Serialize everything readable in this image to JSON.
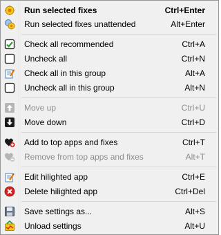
{
  "menu": {
    "items": [
      {
        "label": "Run selected fixes",
        "shortcut": "Ctrl+Enter",
        "icon": "run-icon"
      },
      {
        "label": "Run selected fixes unattended",
        "shortcut": "Alt+Enter",
        "icon": "run-unattended-icon"
      },
      {
        "label": "Check all recommended",
        "shortcut": "Ctrl+A",
        "icon": "checkbox-checked-icon"
      },
      {
        "label": "Uncheck all",
        "shortcut": "Ctrl+N",
        "icon": "checkbox-empty-icon"
      },
      {
        "label": "Check all in this group",
        "shortcut": "Alt+A",
        "icon": "group-check-icon"
      },
      {
        "label": "Uncheck all in this group",
        "shortcut": "Alt+N",
        "icon": "checkbox-empty-icon"
      },
      {
        "label": "Move up",
        "shortcut": "Ctrl+U",
        "icon": "arrow-up-icon",
        "disabled": true
      },
      {
        "label": "Move down",
        "shortcut": "Ctrl+D",
        "icon": "arrow-down-icon"
      },
      {
        "label": "Add to top apps and fixes",
        "shortcut": "Ctrl+T",
        "icon": "heart-add-icon"
      },
      {
        "label": "Remove from top apps and fixes",
        "shortcut": "Alt+T",
        "icon": "heart-remove-icon",
        "disabled": true
      },
      {
        "label": "Edit hilighted app",
        "shortcut": "Ctrl+E",
        "icon": "edit-icon"
      },
      {
        "label": "Delete hilighted app",
        "shortcut": "Ctrl+Del",
        "icon": "delete-icon"
      },
      {
        "label": "Save settings as...",
        "shortcut": "Alt+S",
        "icon": "save-icon"
      },
      {
        "label": "Unload settings",
        "shortcut": "Alt+U",
        "icon": "unload-icon"
      }
    ]
  }
}
